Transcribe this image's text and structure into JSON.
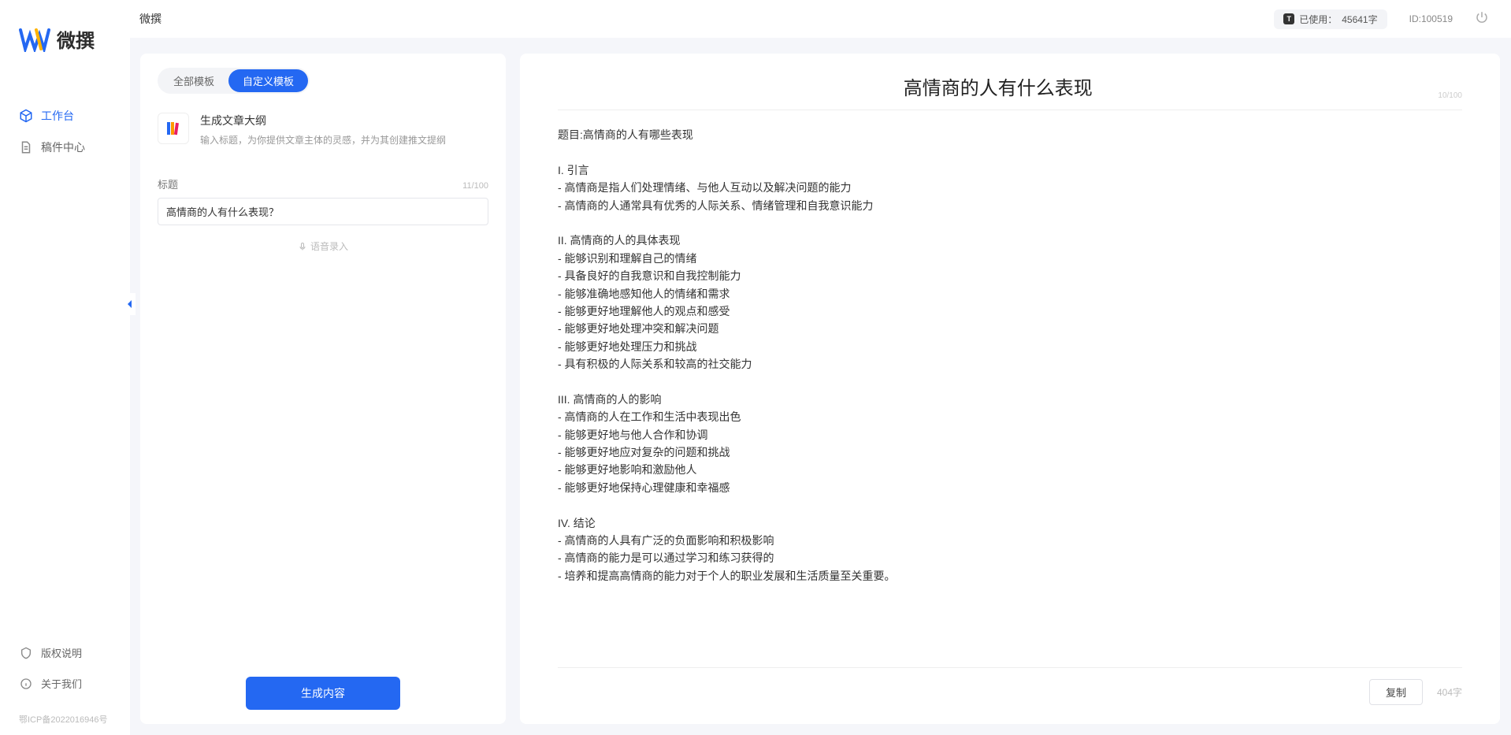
{
  "app": {
    "name": "微撰"
  },
  "sidebar": {
    "nav": [
      {
        "label": "工作台",
        "active": true,
        "icon": "cube"
      },
      {
        "label": "稿件中心",
        "active": false,
        "icon": "doc"
      }
    ],
    "bottom": [
      {
        "label": "版权说明",
        "icon": "shield"
      },
      {
        "label": "关于我们",
        "icon": "info"
      }
    ],
    "icp": "鄂ICP备2022016946号"
  },
  "topbar": {
    "title": "微撰",
    "usage_prefix": "已使用：",
    "usage_value": "45641字",
    "user_id": "ID:100519"
  },
  "left": {
    "tabs": [
      {
        "label": "全部模板",
        "active": false
      },
      {
        "label": "自定义模板",
        "active": true
      }
    ],
    "template": {
      "title": "生成文章大纲",
      "desc": "输入标题，为你提供文章主体的灵感，并为其创建推文提纲"
    },
    "field_label": "标题",
    "field_count": "11/100",
    "title_value": "高情商的人有什么表现？",
    "voice_hint": "语音录入",
    "generate": "生成内容"
  },
  "right": {
    "doc_title": "高情商的人有什么表现",
    "doc_title_count": "10/100",
    "body": "题目:高情商的人有哪些表现\n\nI. 引言\n- 高情商是指人们处理情绪、与他人互动以及解决问题的能力\n- 高情商的人通常具有优秀的人际关系、情绪管理和自我意识能力\n\nII. 高情商的人的具体表现\n- 能够识别和理解自己的情绪\n- 具备良好的自我意识和自我控制能力\n- 能够准确地感知他人的情绪和需求\n- 能够更好地理解他人的观点和感受\n- 能够更好地处理冲突和解决问题\n- 能够更好地处理压力和挑战\n- 具有积极的人际关系和较高的社交能力\n\nIII. 高情商的人的影响\n- 高情商的人在工作和生活中表现出色\n- 能够更好地与他人合作和协调\n- 能够更好地应对复杂的问题和挑战\n- 能够更好地影响和激励他人\n- 能够更好地保持心理健康和幸福感\n\nIV. 结论\n- 高情商的人具有广泛的负面影响和积极影响\n- 高情商的能力是可以通过学习和练习获得的\n- 培养和提高高情商的能力对于个人的职业发展和生活质量至关重要。",
    "copy": "复制",
    "char_count": "404字"
  }
}
